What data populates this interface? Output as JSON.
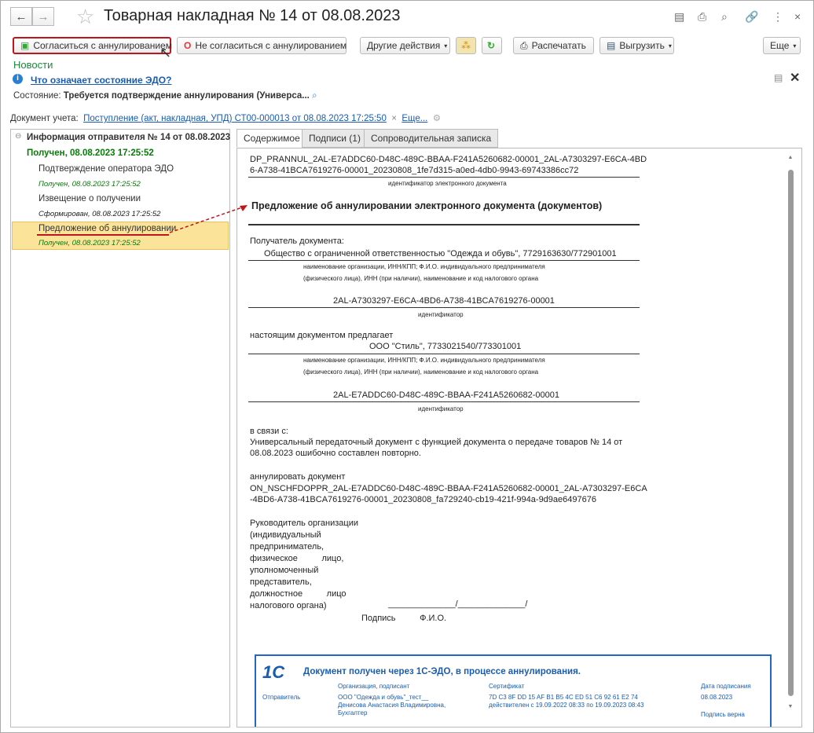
{
  "window": {
    "title": "Товарная накладная № 14 от 08.08.2023"
  },
  "toolbar": {
    "agree": "Согласиться с аннулированием",
    "disagree": "Не согласиться с аннулированием",
    "other": "Другие действия",
    "print": "Распечатать",
    "export": "Выгрузить",
    "more": "Еще"
  },
  "news": "Новости",
  "info_link": "Что означает состояние ЭДО?",
  "state": {
    "label": "Состояние:",
    "value": "Требуется подтверждение аннулирования (Универса..."
  },
  "account_doc": {
    "label": "Документ учета:",
    "value": "Поступление (акт, накладная, УПД) СТ00-000013 от 08.08.2023 17:25:50",
    "more": "Еще..."
  },
  "tree": {
    "root": "Информация отправителя № 14 от 08.08.2023",
    "received": "Получен, 08.08.2023 17:25:52",
    "items": [
      {
        "label": "Подтверждение оператора ЭДО",
        "status": "Получен, 08.08.2023 17:25:52"
      },
      {
        "label": "Извещение о получении",
        "status": "Сформирован, 08.08.2023 17:25:52"
      },
      {
        "label": "Предложение об аннулировании",
        "status": "Получен, 08.08.2023 17:25:52"
      }
    ]
  },
  "tabs": [
    "Содержимое",
    "Подписи (1)",
    "Сопроводительная записка"
  ],
  "doc": {
    "file_id_1": "DP_PRANNUL_2AL-E7ADDC60-D48C-489C-BBAA-F241A5260682-00001_2AL-A7303297-E6CA-4BD",
    "file_id_2": "6-A738-41BCA7619276-00001_20230808_1fe7d315-a0ed-4db0-9943-69743386cc72",
    "file_id_caption": "идентификатор электронного документа",
    "title": "Предложение об аннулировании электронного документа (документов)",
    "recipient_label": "Получатель документа:",
    "recipient": "Общество с ограниченной ответственностью \"Одежда и обувь\", 7729163630/772901001",
    "org_caption_1": "наименование организации, ИНН/КПП; Ф.И.О. индивидуального предпринимателя",
    "org_caption_2": "(физического лица), ИНН (при наличии), наименование и код налогового органа",
    "recipient_id": "2AL-A7303297-E6CA-4BD6-A738-41BCA7619276-00001",
    "id_caption": "идентификатор",
    "proposes": "настоящим документом предлагает",
    "sender": "ООО \"Стиль\", 7733021540/773301001",
    "sender_id": "2AL-E7ADDC60-D48C-489C-BBAA-F241A5260682-00001",
    "reason_label": "в связи с:",
    "reason_1": "Универсальный передаточный документ с функцией документа о передаче товаров  № 14 от",
    "reason_2": "08.08.2023 ошибочно составлен повторно.",
    "annul_label": "аннулировать документ",
    "annul_1": "ON_NSCHFDOPPR_2AL-E7ADDC60-D48C-489C-BBAA-F241A5260682-00001_2AL-A7303297-E6CA",
    "annul_2": "-4BD6-A738-41BCA7619276-00001_20230808_fa729240-cb19-421f-994a-9d9ae6497676",
    "head_lines": [
      "Руководитель  организации",
      "(индивидуальный",
      "предприниматель,",
      "физическое          лицо,",
      "уполномоченный",
      "представитель,",
      "должностное          лицо",
      "налогового органа)"
    ],
    "sign_line": "______________/______________/",
    "sign_caption": "Подпись          Ф.И.О.",
    "stamp": {
      "title": "Документ получен через 1С-ЭДО, в процессе аннулирования.",
      "col_org": "Организация, подписант",
      "col_cert": "Сертификат",
      "col_date": "Дата подписания",
      "row_label": "Отправитель",
      "org_1": "ООО \"Одежда и обувь\"_тест__",
      "org_2": "Денисова Анастасия Владимировна,",
      "org_3": "Бухгалтер",
      "cert_1": "7D C3 8F DD 15 AF B1 B5 4C ED 51 C6 92 61 E2 74",
      "cert_2": "действителен с 19.09.2022 08:33 по 19.09.2023 08:43",
      "date": "08.08.2023",
      "valid": "Подпись верна"
    }
  }
}
